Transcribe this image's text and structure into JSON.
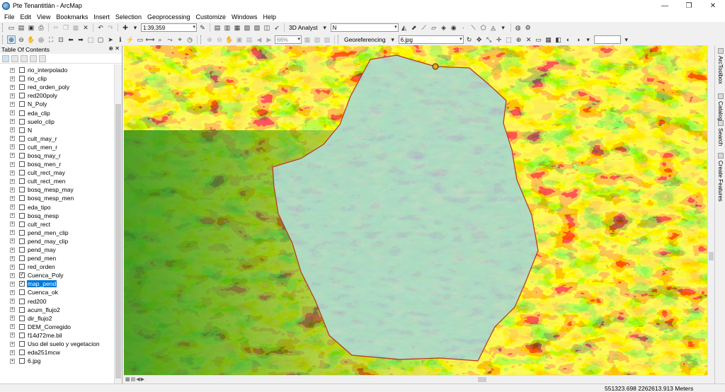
{
  "window": {
    "title": "Pte Tenantitlán - ArcMap"
  },
  "menu": [
    "File",
    "Edit",
    "View",
    "Bookmarks",
    "Insert",
    "Selection",
    "Geoprocessing",
    "Customize",
    "Windows",
    "Help"
  ],
  "toolbar": {
    "scale": "1:39,359",
    "analyst_label": "3D Analyst",
    "layer_select": "N",
    "zoom_percent": "66%",
    "georef_label": "Georeferencing",
    "georef_layer": "6.jpg"
  },
  "toc": {
    "title": "Table Of Contents",
    "layers": [
      {
        "name": "rio_interpolado",
        "checked": false
      },
      {
        "name": "rio_clip",
        "checked": false
      },
      {
        "name": "red_orden_poly",
        "checked": false
      },
      {
        "name": "red200poly",
        "checked": false
      },
      {
        "name": "N_Poly",
        "checked": false
      },
      {
        "name": "eda_clip",
        "checked": false
      },
      {
        "name": "suelo_clip",
        "checked": false
      },
      {
        "name": "N",
        "checked": false
      },
      {
        "name": "cult_may_r",
        "checked": false
      },
      {
        "name": "cult_men_r",
        "checked": false
      },
      {
        "name": "bosq_may_r",
        "checked": false
      },
      {
        "name": "bosq_men_r",
        "checked": false
      },
      {
        "name": "cult_rect_may",
        "checked": false
      },
      {
        "name": "cult_rect_men",
        "checked": false
      },
      {
        "name": "bosq_mesp_may",
        "checked": false
      },
      {
        "name": "bosq_mesp_men",
        "checked": false
      },
      {
        "name": "eda_tipo",
        "checked": false
      },
      {
        "name": "bosq_mesp",
        "checked": false
      },
      {
        "name": "cult_rect",
        "checked": false
      },
      {
        "name": "pend_men_clip",
        "checked": false
      },
      {
        "name": "pend_may_clip",
        "checked": false
      },
      {
        "name": "pend_may",
        "checked": false
      },
      {
        "name": "pend_men",
        "checked": false
      },
      {
        "name": "red_orden",
        "checked": false
      },
      {
        "name": "Cuenca_Poly",
        "checked": true
      },
      {
        "name": "map_pend",
        "checked": true,
        "selected": true
      },
      {
        "name": "Cuenca_ok",
        "checked": false
      },
      {
        "name": "red200",
        "checked": false
      },
      {
        "name": "acum_flujo2",
        "checked": false
      },
      {
        "name": "dir_flujo2",
        "checked": false
      },
      {
        "name": "DEM_Corregido",
        "checked": false
      },
      {
        "name": "f14d72me.bil",
        "checked": false
      },
      {
        "name": "Uso del suelo y vegetacion",
        "checked": false
      },
      {
        "name": "eda251mcw",
        "checked": false
      },
      {
        "name": "6.jpg",
        "checked": false
      }
    ]
  },
  "dock_tabs": [
    "ArcToolbox",
    "Catalog",
    "Search",
    "Create Features"
  ],
  "status": {
    "coordinates": "551323.698  2262613.913 Meters"
  },
  "map_colors": {
    "low": "#2f8f1e",
    "mid": "#a8e01a",
    "yellow": "#f4f20f",
    "orange": "#ff8a00",
    "high": "#e0110f",
    "basin_fill": "#8fd3c0",
    "basin_outline": "#b5361c"
  }
}
